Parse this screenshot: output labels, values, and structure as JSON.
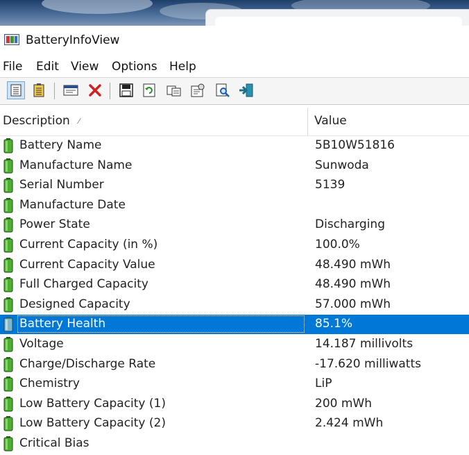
{
  "window": {
    "title": "BatteryInfoView",
    "app_icon": "battery-app-icon"
  },
  "menu": [
    {
      "label": "File"
    },
    {
      "label": "Edit"
    },
    {
      "label": "View"
    },
    {
      "label": "Options"
    },
    {
      "label": "Help"
    }
  ],
  "toolbar": {
    "buttons": [
      {
        "icon": "battery-info-mode-icon",
        "pressed": true
      },
      {
        "icon": "battery-log-mode-icon",
        "pressed": false
      },
      {
        "icon": "properties-window-icon",
        "pressed": false
      },
      {
        "icon": "delete-x-icon",
        "pressed": false
      },
      {
        "icon": "save-icon",
        "pressed": false
      },
      {
        "icon": "refresh-icon",
        "pressed": false
      },
      {
        "icon": "copy-icon",
        "pressed": false
      },
      {
        "icon": "properties-icon",
        "pressed": false
      },
      {
        "icon": "find-icon",
        "pressed": false
      },
      {
        "icon": "exit-icon",
        "pressed": false
      }
    ]
  },
  "columns": {
    "description": "Description",
    "value": "Value"
  },
  "rows": [
    {
      "description": "Battery Name",
      "value": "5B10W51816"
    },
    {
      "description": "Manufacture Name",
      "value": "Sunwoda"
    },
    {
      "description": "Serial Number",
      "value": " 5139"
    },
    {
      "description": "Manufacture Date",
      "value": ""
    },
    {
      "description": "Power State",
      "value": "Discharging"
    },
    {
      "description": "Current Capacity (in %)",
      "value": "100.0%"
    },
    {
      "description": "Current Capacity Value",
      "value": "48.490 mWh"
    },
    {
      "description": "Full Charged Capacity",
      "value": "48.490 mWh"
    },
    {
      "description": "Designed Capacity",
      "value": "57.000 mWh"
    },
    {
      "description": "Battery Health",
      "value": "85.1%",
      "selected": true
    },
    {
      "description": "Voltage",
      "value": "14.187 millivolts"
    },
    {
      "description": "Charge/Discharge Rate",
      "value": "-17.620 milliwatts"
    },
    {
      "description": "Chemistry",
      "value": "LiP"
    },
    {
      "description": "Low Battery Capacity (1)",
      "value": "200 mWh"
    },
    {
      "description": "Low Battery Capacity (2)",
      "value": "2.424 mWh"
    },
    {
      "description": "Critical Bias",
      "value": ""
    }
  ],
  "colors": {
    "selection": "#0078d7",
    "battery_green": "#3f9a2a"
  }
}
